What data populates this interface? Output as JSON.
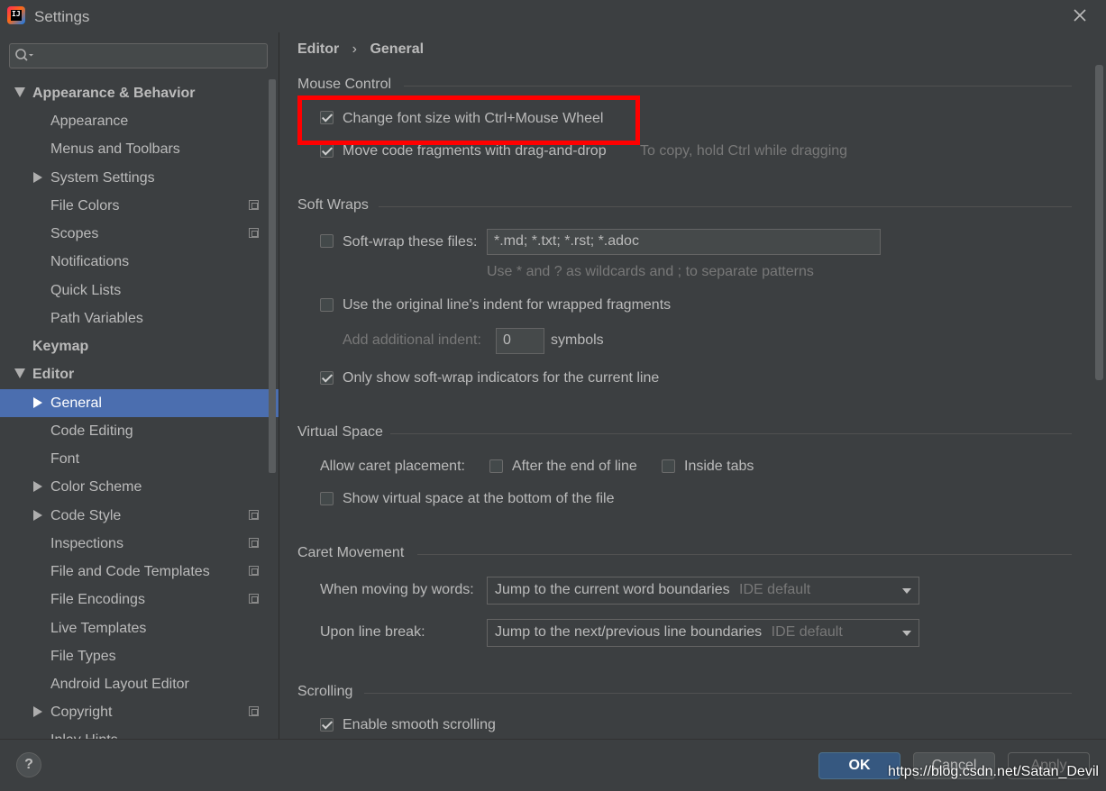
{
  "window": {
    "title": "Settings",
    "app_logo_text": "IJ"
  },
  "sidebar": {
    "search": {
      "placeholder": ""
    },
    "items": [
      {
        "label": "Appearance & Behavior"
      },
      {
        "label": "Appearance"
      },
      {
        "label": "Menus and Toolbars"
      },
      {
        "label": "System Settings"
      },
      {
        "label": "File Colors"
      },
      {
        "label": "Scopes"
      },
      {
        "label": "Notifications"
      },
      {
        "label": "Quick Lists"
      },
      {
        "label": "Path Variables"
      },
      {
        "label": "Keymap"
      },
      {
        "label": "Editor"
      },
      {
        "label": "General"
      },
      {
        "label": "Code Editing"
      },
      {
        "label": "Font"
      },
      {
        "label": "Color Scheme"
      },
      {
        "label": "Code Style"
      },
      {
        "label": "Inspections"
      },
      {
        "label": "File and Code Templates"
      },
      {
        "label": "File Encodings"
      },
      {
        "label": "Live Templates"
      },
      {
        "label": "File Types"
      },
      {
        "label": "Android Layout Editor"
      },
      {
        "label": "Copyright"
      },
      {
        "label": "Inlay Hints"
      }
    ]
  },
  "breadcrumb": {
    "parent": "Editor",
    "separator": "›",
    "current": "General"
  },
  "mouse_control": {
    "title": "Mouse Control",
    "change_font_size": {
      "label": "Change font size with Ctrl+Mouse Wheel",
      "checked": true
    },
    "move_code_fragments": {
      "label": "Move code fragments with drag-and-drop",
      "checked": true,
      "hint": "To copy, hold Ctrl while dragging"
    }
  },
  "soft_wraps": {
    "title": "Soft Wraps",
    "soft_wrap_files": {
      "label": "Soft-wrap these files:",
      "checked": false,
      "value": "*.md; *.txt; *.rst; *.adoc",
      "hint": "Use * and ? as wildcards and ; to separate patterns"
    },
    "use_original_indent": {
      "label": "Use the original line's indent for wrapped fragments",
      "checked": false
    },
    "additional_indent": {
      "label": "Add additional indent:",
      "value": "0",
      "suffix": "symbols"
    },
    "only_show_indicators": {
      "label": "Only show soft-wrap indicators for the current line",
      "checked": true
    }
  },
  "virtual_space": {
    "title": "Virtual Space",
    "caret_placement_label": "Allow caret placement:",
    "after_end_of_line": {
      "label": "After the end of line",
      "checked": false
    },
    "inside_tabs": {
      "label": "Inside tabs",
      "checked": false
    },
    "show_virtual_space": {
      "label": "Show virtual space at the bottom of the file",
      "checked": false
    }
  },
  "caret_movement": {
    "title": "Caret Movement",
    "moving_by_words": {
      "label": "When moving by words:",
      "value": "Jump to the current word boundaries",
      "hint": "IDE default"
    },
    "line_break": {
      "label": "Upon line break:",
      "value": "Jump to the next/previous line boundaries",
      "hint": "IDE default"
    }
  },
  "scrolling": {
    "title": "Scrolling",
    "smooth_scrolling": {
      "label": "Enable smooth scrolling",
      "checked": true
    }
  },
  "buttons": {
    "help": "?",
    "ok": "OK",
    "cancel": "Cancel",
    "apply": "Apply"
  },
  "watermark": "https://blog.csdn.net/Satan_Devil",
  "colors": {
    "selection": "#4b6eaf",
    "highlight_box": "#ff0000",
    "ok_button": "#365880"
  }
}
